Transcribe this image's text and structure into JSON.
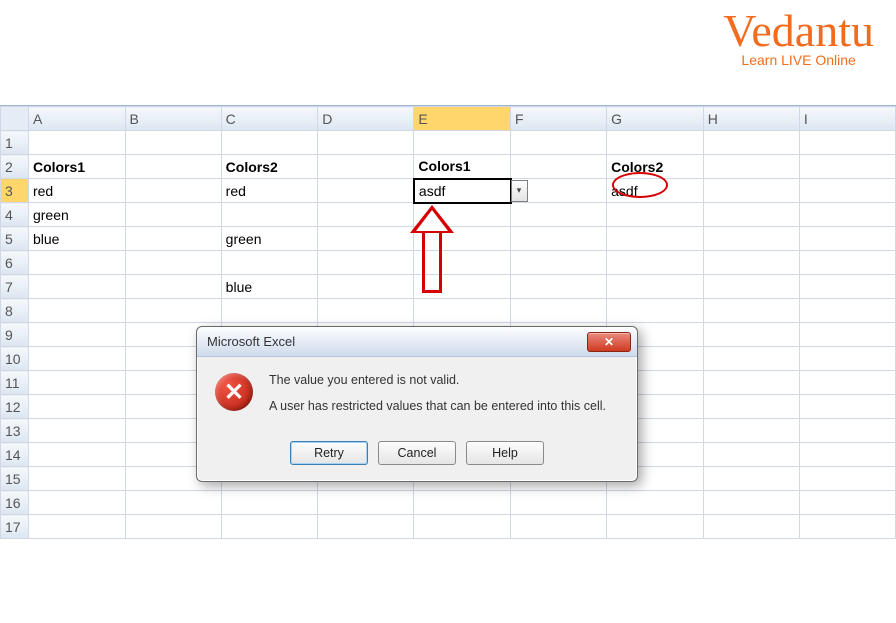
{
  "logo": {
    "brand": "Vedantu",
    "tagline": "Learn LIVE Online"
  },
  "columns": [
    "A",
    "B",
    "C",
    "D",
    "E",
    "F",
    "G",
    "H",
    "I"
  ],
  "rows": [
    1,
    2,
    3,
    4,
    5,
    6,
    7,
    8,
    9,
    10,
    11,
    12,
    13,
    14,
    15,
    16,
    17
  ],
  "selected_col": "E",
  "selected_row": 3,
  "cells": {
    "A2": "Colors1",
    "C2": "Colors2",
    "E2": "Colors1",
    "G2": "Colors2",
    "A3": "red",
    "C3": "red",
    "E3": "asdf",
    "G3": "asdf",
    "A4": "green",
    "A5": "blue",
    "C5": "green",
    "C7": "blue"
  },
  "bold_cells": [
    "A2",
    "C2",
    "E2",
    "G2"
  ],
  "active_cell": "E3",
  "dropdown_icon": "▾",
  "dialog": {
    "title": "Microsoft Excel",
    "close_glyph": "✕",
    "error_glyph": "✕",
    "line1": "The value you entered is not valid.",
    "line2": "A user has restricted values that can be entered into this cell.",
    "retry": "Retry",
    "cancel": "Cancel",
    "help": "Help"
  }
}
